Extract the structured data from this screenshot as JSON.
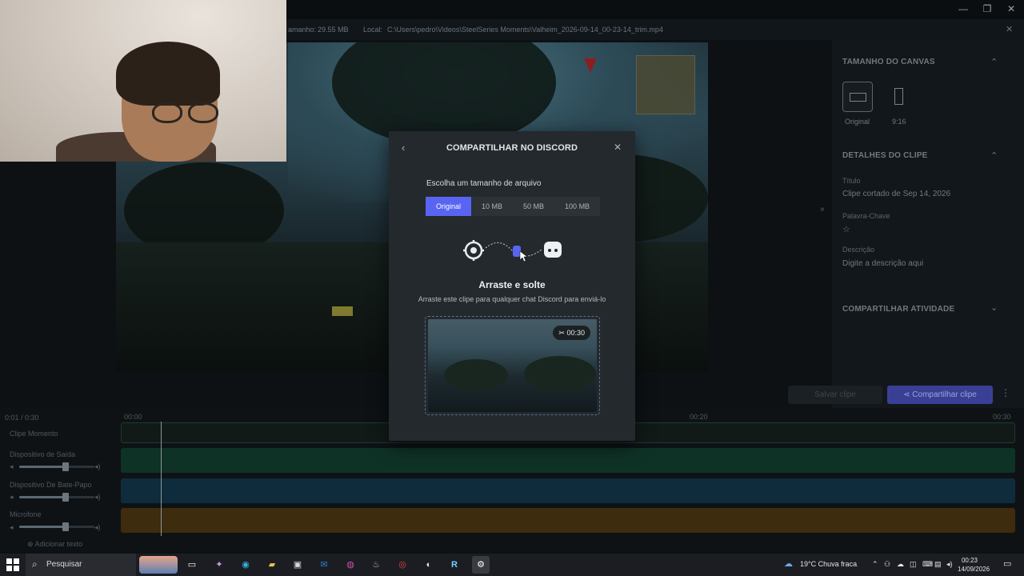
{
  "window": {
    "minimize": "—",
    "maximize": "❐",
    "close": "✕",
    "info_close": "✕"
  },
  "infobar": {
    "size_label": "amanho:",
    "size_value": "29.55 MB",
    "location_label": "Local:",
    "location_value": "C:\\Users\\pedro\\Videos\\SteelSeries Moments\\Valheim_2026-09-14_00-23-14_trim.mp4"
  },
  "right_panel": {
    "canvas_section": "TAMANHO DO CANVAS",
    "canvas_options": [
      "Original",
      "9:16"
    ],
    "clip_details_section": "DETALHES DO CLIPE",
    "title_label": "Título",
    "title_value": "Clipe cortado de Sep 14, 2026",
    "keyword_label": "Palavra-Chave",
    "description_label": "Descrição",
    "description_placeholder": "Digite a descrição aqui",
    "share_activity_section": "COMPARTILHAR ATIVIDADE"
  },
  "actions": {
    "disabled_label": "Salvar clipe",
    "share_label": "Compartilhar clipe"
  },
  "timeline": {
    "current": "0:01 / 0:30",
    "t0": "00:00",
    "t20": "00:20",
    "t30": "00:30",
    "tracks": [
      "Clipe Momento",
      "Dispositivo de Saída",
      "Dispositivo De Bate-Papo",
      "Microfone"
    ],
    "add_text": "Adicionar texto",
    "volumes": [
      0.62,
      0.62,
      0.62
    ]
  },
  "modal": {
    "title": "COMPARTILHAR NO DISCORD",
    "back": "‹",
    "close": "✕",
    "size_label": "Escolha um tamanho de arquivo",
    "size_options": [
      "Original",
      "10 MB",
      "50 MB",
      "100 MB"
    ],
    "drag_title": "Arraste e solte",
    "drag_subtitle": "Arraste este clipe para qualquer chat Discord para enviá-lo",
    "clip_duration": "00:30"
  },
  "taskbar": {
    "search_placeholder": "Pesquisar",
    "weather": "19°C  Chuva fraca",
    "time": "00:23",
    "date": "14/09/2026",
    "app_r": "R"
  },
  "colors": {
    "accent": "#5865f2",
    "track_moment": "#123a2c",
    "track_output": "#0f3a2a",
    "track_chat": "#103244",
    "track_mic": "#4a3410"
  }
}
